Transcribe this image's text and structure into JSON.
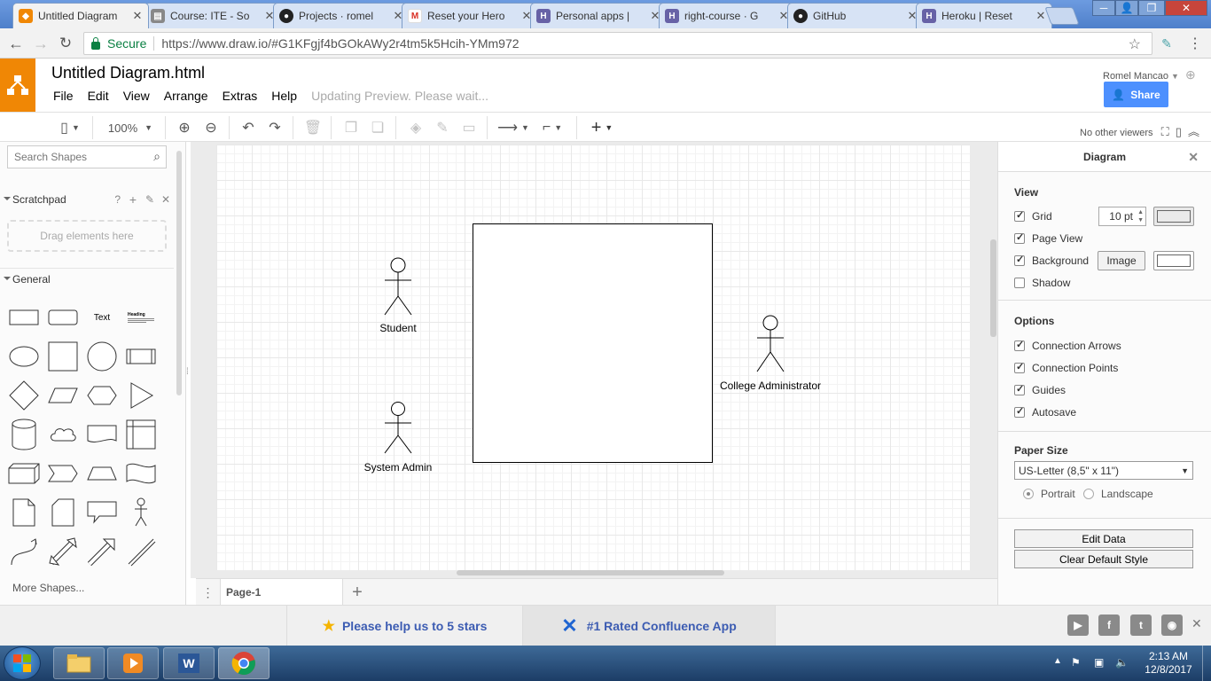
{
  "browser": {
    "tabs": [
      {
        "title": "Untitled Diagram",
        "icon": "drawio-icon",
        "color": "#f08705",
        "active": true
      },
      {
        "title": "Course: ITE - So",
        "icon": "moodle-icon",
        "color": "#888888",
        "active": false
      },
      {
        "title": "Projects · romel",
        "icon": "github-icon",
        "color": "#222222",
        "active": false
      },
      {
        "title": "Reset your Hero",
        "icon": "gmail-icon",
        "color": "#d93025",
        "active": false
      },
      {
        "title": "Personal apps |",
        "icon": "heroku-icon",
        "color": "#6762a6",
        "active": false
      },
      {
        "title": "right-course · G",
        "icon": "heroku-icon",
        "color": "#6762a6",
        "active": false
      },
      {
        "title": "GitHub",
        "icon": "github-icon",
        "color": "#222222",
        "active": false
      },
      {
        "title": "Heroku | Reset",
        "icon": "heroku-icon",
        "color": "#6762a6",
        "active": false
      }
    ],
    "secure_label": "Secure",
    "url": "https://www.draw.io/#G1KFgjf4bGOkAWy2r4tm5k5Hcih-YMm972"
  },
  "app": {
    "title": "Untitled Diagram.html",
    "menu": [
      "File",
      "Edit",
      "View",
      "Arrange",
      "Extras",
      "Help"
    ],
    "status": "Updating Preview. Please wait...",
    "user": "Romel Mancao",
    "share_label": "Share",
    "zoom": "100%",
    "viewers": "No other viewers",
    "accent": "#f08705"
  },
  "sidebar": {
    "search_placeholder": "Search Shapes",
    "scratchpad_label": "Scratchpad",
    "scratchpad_help": "?",
    "drag_hint": "Drag elements here",
    "general_label": "General",
    "text_shape_label": "Text",
    "heading_shape_label": "Heading",
    "more_shapes": "More Shapes..."
  },
  "diagram": {
    "actors": {
      "student": "Student",
      "system_admin": "System Admin",
      "college_admin": "College Administrator"
    }
  },
  "pages": {
    "current": "Page-1"
  },
  "format_panel": {
    "title": "Diagram",
    "view_head": "View",
    "grid_label": "Grid",
    "grid_size": "10 pt",
    "page_view_label": "Page View",
    "background_label": "Background",
    "image_button": "Image",
    "shadow_label": "Shadow",
    "options_head": "Options",
    "connection_arrows": "Connection Arrows",
    "connection_points": "Connection Points",
    "guides": "Guides",
    "autosave": "Autosave",
    "paper_head": "Paper Size",
    "paper_size": "US-Letter (8,5\" x 11\")",
    "portrait": "Portrait",
    "landscape": "Landscape",
    "edit_data": "Edit Data",
    "clear_style": "Clear Default Style"
  },
  "footer": {
    "promo_stars": "Please help us to 5 stars",
    "promo_confluence": "#1 Rated Confluence App"
  },
  "taskbar": {
    "time": "2:13 AM",
    "date": "12/8/2017"
  }
}
